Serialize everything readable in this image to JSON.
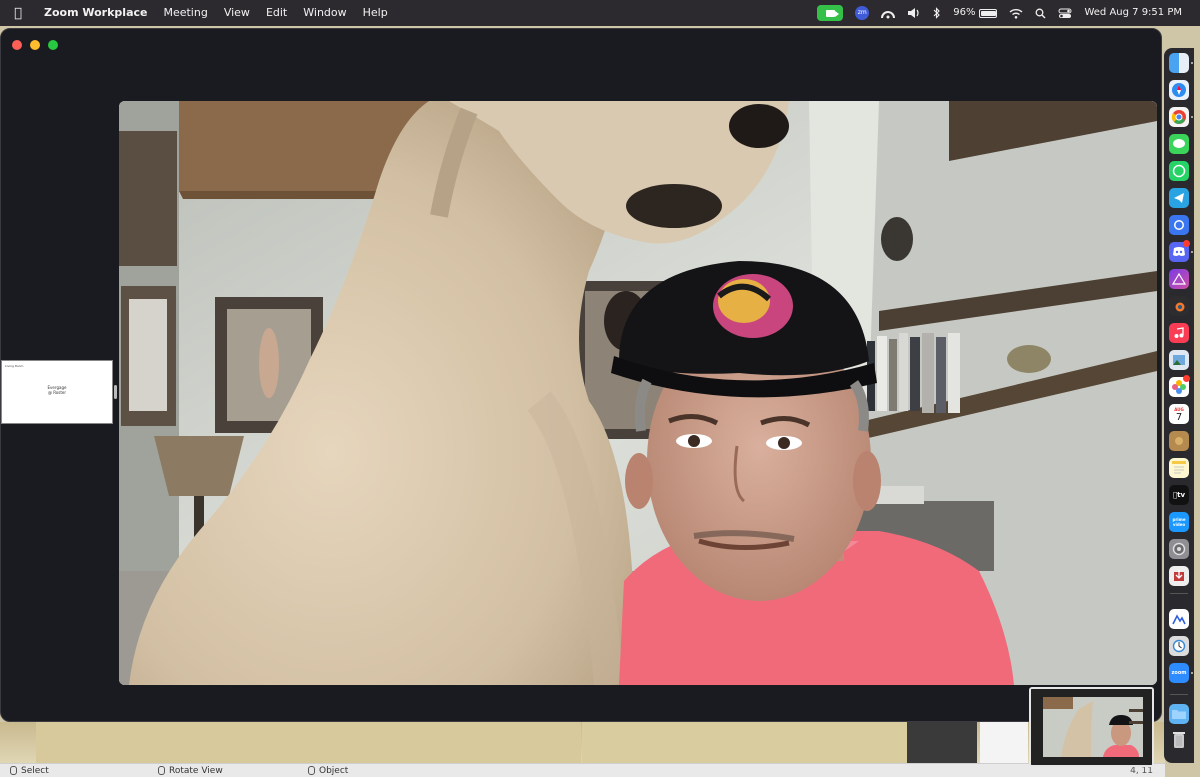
{
  "menubar": {
    "apple_icon": "apple-logo",
    "app_name": "Zoom Workplace",
    "menus": [
      "Meeting",
      "View",
      "Edit",
      "Window",
      "Help"
    ],
    "status": {
      "battery": "96%",
      "datetime": "Wed Aug 7  9:51 PM",
      "zm_badge": "zm"
    }
  },
  "side_panel": {
    "title": "Living Room",
    "name_line1": "Evergage",
    "name_line2": "@ Roster"
  },
  "dock": {
    "calendar_month": "AUG",
    "calendar_day": "7",
    "tv_label": "tv",
    "prime_label": "prime video",
    "zoom_label": "zoom"
  },
  "statusbar": {
    "select": "Select",
    "rotate": "Rotate View",
    "object": "Object",
    "coords": "4, 11"
  },
  "colors": {
    "menubar_bg": "#2c2a2e",
    "window_bg": "#1a1b20",
    "camera_green": "#35c04a",
    "shirt_pink": "#f06a7a"
  }
}
